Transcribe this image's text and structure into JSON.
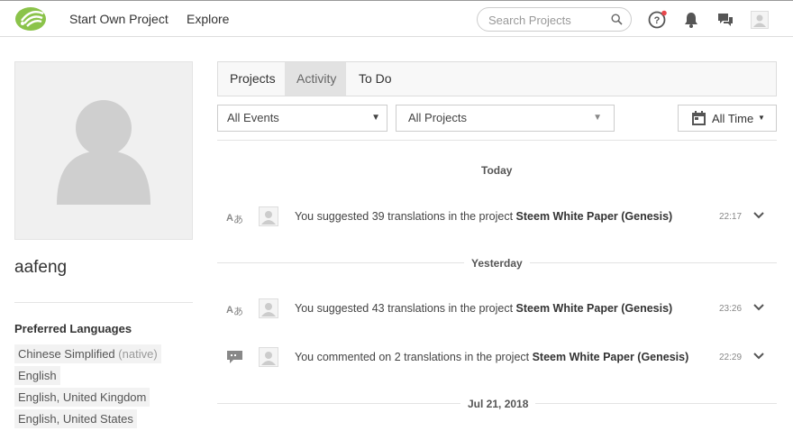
{
  "header": {
    "nav": [
      "Start Own Project",
      "Explore"
    ],
    "search_placeholder": "Search Projects",
    "icons": [
      "logo-icon",
      "help-icon",
      "bell-icon",
      "messages-icon",
      "user-avatar"
    ],
    "notification_dot_color": "#e8474c"
  },
  "profile": {
    "username": "aafeng",
    "preferred_title": "Preferred Languages",
    "languages": [
      {
        "name": "Chinese Simplified",
        "tag": "(native)"
      },
      {
        "name": "English",
        "tag": ""
      },
      {
        "name": "English, United Kingdom",
        "tag": ""
      },
      {
        "name": "English, United States",
        "tag": ""
      }
    ]
  },
  "tabs": [
    {
      "label": "Projects"
    },
    {
      "label": "Activity"
    },
    {
      "label": "To Do"
    }
  ],
  "filters": {
    "events": "All Events",
    "projects": "All Projects",
    "time": "All Time"
  },
  "activity": {
    "groups": [
      {
        "day": "Today",
        "items": [
          {
            "icon": "translate-icon",
            "prefix": "You suggested 39 translations in the project ",
            "project": "Steem White Paper (Genesis)",
            "time": "22:17"
          }
        ]
      },
      {
        "day": "Yesterday",
        "items": [
          {
            "icon": "translate-icon",
            "prefix": "You suggested 43 translations in the project ",
            "project": "Steem White Paper (Genesis)",
            "time": "23:26"
          },
          {
            "icon": "comment-icon",
            "prefix": "You commented on 2 translations in the project ",
            "project": "Steem White Paper (Genesis)",
            "time": "22:29"
          }
        ]
      },
      {
        "day": "Jul 21, 2018",
        "items": []
      }
    ]
  }
}
